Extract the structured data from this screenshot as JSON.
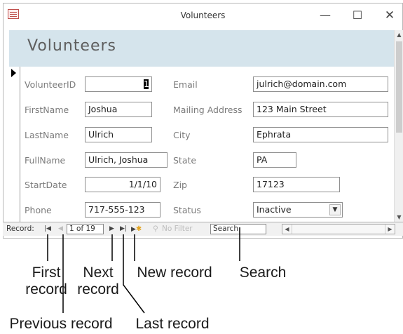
{
  "window": {
    "title": "Volunteers",
    "minimize": "—",
    "maximize": "☐",
    "close": "✕"
  },
  "form": {
    "title": "Volunteers",
    "labels": {
      "volunteer_id": "VolunteerID",
      "first_name": "FirstName",
      "last_name": "LastName",
      "full_name": "FullName",
      "start_date": "StartDate",
      "phone": "Phone",
      "email": "Email",
      "mailing_address": "Mailing Address",
      "city": "City",
      "state": "State",
      "zip": "Zip",
      "status": "Status"
    },
    "values": {
      "volunteer_id": "1",
      "first_name": "Joshua",
      "last_name": "Ulrich",
      "full_name": "Ulrich,  Joshua",
      "start_date": "1/1/10",
      "phone": "717-555-123",
      "email": "julrich@domain.com",
      "mailing_address": "123 Main Street",
      "city": "Ephrata",
      "state": "PA",
      "zip": "17123",
      "status": "Inactive"
    }
  },
  "navigation": {
    "record_label": "Record:",
    "position": "1 of 19",
    "filter_label": "No Filter",
    "search_value": "Search",
    "first_icon": "first-record-icon",
    "previous_icon": "previous-record-icon",
    "next_icon": "next-record-icon",
    "last_icon": "last-record-icon",
    "new_icon": "new-record-icon"
  },
  "callouts": {
    "first_record": "First\nrecord",
    "next_record": "Next\nrecord",
    "new_record": "New record",
    "search": "Search",
    "previous_record": "Previous record",
    "last_record": "Last record"
  }
}
